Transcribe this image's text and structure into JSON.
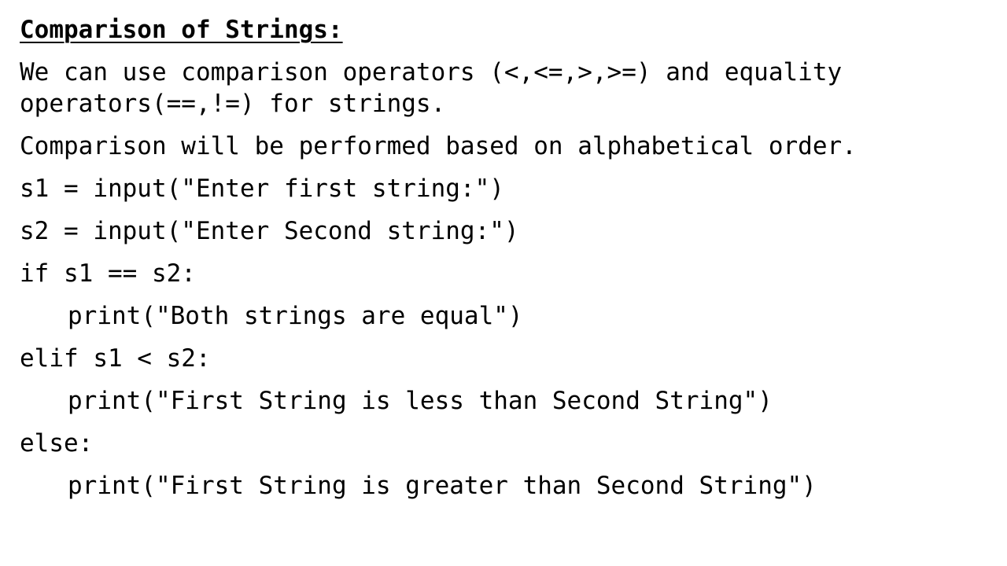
{
  "title": "Comparison of Strings:",
  "intro_line1": "We can use comparison operators (<,<=,>,>=) and equality",
  "intro_line2": "operators(==,!=) for strings.",
  "note": "Comparison will be performed based on alphabetical order.",
  "code": [
    "s1 = input(\"Enter first string:\")",
    "s2 = input(\"Enter Second string:\")",
    "if s1 == s2:",
    "print(\"Both strings are equal\")",
    "elif s1 < s2:",
    "print(\"First String is less than Second String\")",
    "else:",
    "print(\"First String is greater than Second String\")"
  ]
}
